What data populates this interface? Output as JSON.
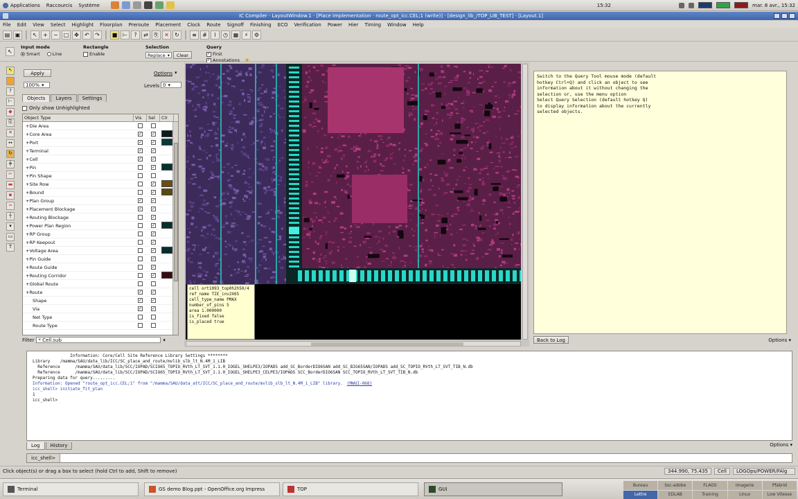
{
  "top_panel": {
    "menus": [
      "Applications",
      "Raccourcis",
      "Système"
    ],
    "clock": "mar. 8 avr., 15:32",
    "time_center": "15:32"
  },
  "window": {
    "title": "IC Compiler · LayoutWindow.1 · [Place Implementation · route_opt_icc.CEL;1 (write)] · [design_lib_/TOP_LIB_TEST] · [Layout.1]"
  },
  "menubar": [
    "File",
    "Edit",
    "View",
    "Select",
    "Highlight",
    "Floorplan",
    "Preroute",
    "Placement",
    "Clock",
    "Route",
    "Signoff",
    "Finishing",
    "ECO",
    "Verification",
    "Power",
    "Hier",
    "Timing",
    "Window",
    "Help"
  ],
  "options": {
    "input_mode": {
      "head": "Input mode",
      "smart": "Smart",
      "line": "Line"
    },
    "rect_type": {
      "head": "Rectangle",
      "enable": "Enable"
    },
    "selection": {
      "head": "Selection",
      "value": "Replace",
      "clear": "Clear"
    },
    "query": {
      "head": "Query",
      "first": "First",
      "annotations": "Annotations"
    }
  },
  "left_panel": {
    "apply": "Apply",
    "options_label": "Options",
    "zoom_value": "100%",
    "levels_label": "Levels",
    "levels_value": "0",
    "tabs": [
      "Objects",
      "Layers",
      "Settings"
    ],
    "show_highlighted": "Only show Unhighlighted",
    "columns": [
      "Object Type",
      "Vis",
      "Sel",
      "Clr"
    ],
    "rows": [
      {
        "name": "Die Area",
        "vis": false,
        "sel": false,
        "color": "",
        "sub": false
      },
      {
        "name": "Core Area",
        "vis": true,
        "sel": true,
        "color": "#0b1a1c",
        "sub": false
      },
      {
        "name": "Port",
        "vis": true,
        "sel": true,
        "color": "#083a3a",
        "sub": false
      },
      {
        "name": "Terminal",
        "vis": true,
        "sel": true,
        "color": "",
        "sub": false
      },
      {
        "name": "Cell",
        "vis": true,
        "sel": true,
        "color": "",
        "sub": false
      },
      {
        "name": "Pin",
        "vis": false,
        "sel": true,
        "color": "#04332e",
        "sub": false
      },
      {
        "name": "Pin Shape",
        "vis": false,
        "sel": false,
        "color": "",
        "sub": false
      },
      {
        "name": "Site Row",
        "vis": false,
        "sel": true,
        "color": "#6a4e0f",
        "sub": false
      },
      {
        "name": "Bound",
        "vis": false,
        "sel": true,
        "color": "#5a4a10",
        "sub": false
      },
      {
        "name": "Plan Group",
        "vis": true,
        "sel": true,
        "color": "",
        "sub": false
      },
      {
        "name": "Placement Blockage",
        "vis": true,
        "sel": true,
        "color": "",
        "sub": false
      },
      {
        "name": "Routing Blockage",
        "vis": false,
        "sel": true,
        "color": "",
        "sub": false
      },
      {
        "name": "Power Plan Region",
        "vis": false,
        "sel": true,
        "color": "#04302c",
        "sub": false
      },
      {
        "name": "RP Group",
        "vis": false,
        "sel": true,
        "color": "",
        "sub": false
      },
      {
        "name": "RP Keepout",
        "vis": false,
        "sel": true,
        "color": "",
        "sub": false
      },
      {
        "name": "Voltage Area",
        "vis": false,
        "sel": true,
        "color": "#052e2d",
        "sub": false
      },
      {
        "name": "Pin Guide",
        "vis": false,
        "sel": true,
        "color": "",
        "sub": false
      },
      {
        "name": "Route Guide",
        "vis": false,
        "sel": true,
        "color": "",
        "sub": false
      },
      {
        "name": "Routing Corridor",
        "vis": false,
        "sel": true,
        "color": "#3a0a10",
        "sub": false
      },
      {
        "name": "Global Route",
        "vis": false,
        "sel": false,
        "color": "",
        "sub": false
      },
      {
        "name": "Route",
        "vis": true,
        "sel": true,
        "color": "",
        "sub": false
      },
      {
        "name": "Shape",
        "vis": true,
        "sel": true,
        "color": "",
        "sub": true
      },
      {
        "name": "Via",
        "vis": true,
        "sel": true,
        "color": "",
        "sub": true
      },
      {
        "name": "Net Type",
        "vis": false,
        "sel": false,
        "color": "",
        "sub": true
      },
      {
        "name": "Route Type",
        "vis": false,
        "sel": false,
        "color": "",
        "sub": true
      }
    ],
    "filter_label": "Filter",
    "filter_value": "* Cell.sub"
  },
  "query_box": {
    "lines": [
      "cell  ort1093_top0h2h50/4",
      "ref_name  TIE_inv2X65",
      "cell_type_name  PMAX",
      "number_of_pins  5",
      "area  1.000000",
      "is_fixed  false",
      "is_placed  true"
    ]
  },
  "help_panel": {
    "text": "Switch to the Query Tool mouse mode (default\nhotkey Ctrl+Q) and click an object to see\ninformation about it without changing the\nselection or, use the menu option\nSelect Query Selection (default hotkey Q)\nto display information about the currently\nselected objects.",
    "back": "Back to Log",
    "options": "Options"
  },
  "console": {
    "lines": [
      {
        "text": "               Information: Core/Cell Site Reference Library Settings ********",
        "cls": ""
      },
      {
        "text": "",
        "cls": ""
      },
      {
        "text": "Library    /mamma/SAU/data_lib/ICC/SC_place_and_route/mvlib_slb_lt_N.4M_1_LIB",
        "cls": ""
      },
      {
        "text": "  Reference      /mamma/SAU/data_lib/SCC/IOPAD/SCIO65_TOPIO_RVth_LT_SVT_1.1.0_IOGEL_SHELPE3/IOPADS add_SC_BorderDIO6SAN add_SC_BIG65SAN/IOPADS add_SC_TOPIO_RVth_LT_SVT_TIB_N.db",
        "cls": ""
      },
      {
        "text": "  Reference      /mamma/SAU/data_lib/SCC/IOPAD/SCIO65_TOPIO_RVth_LT_SVT_1.1.0_IOGEL_SHELPE3_CELPE3/IOPADS SCC_BorderDIO6SAN SCC_TOPIO_RVth_LT_SVT_TIB_N.db",
        "cls": ""
      },
      {
        "text": "",
        "cls": ""
      },
      {
        "text": "",
        "cls": ""
      },
      {
        "text": "Preparing data for query.........",
        "cls": ""
      },
      {
        "text": "Information: Opened \"route_opt_icc.CEL;1\" from \"/mamma/SAU/data_att/ICC/SC_place_and_route/mvlib_slb_lt_N.4M_1_LIB\" library.",
        "cls": "blue",
        "link": "(MWUI-068)"
      },
      {
        "text": "icc_shell> initiate_fit_plan",
        "cls": "blue"
      },
      {
        "text": "1",
        "cls": ""
      },
      {
        "text": "icc_shell>",
        "cls": ""
      }
    ],
    "tabs": [
      "Log",
      "History"
    ],
    "options": "Options",
    "prompt": "icc_shell>"
  },
  "status": {
    "message": "Click object(s) or drag a box to select (hold Ctrl to add, Shift to remove)",
    "coords": "344.990, 75.435",
    "layer": "Cell",
    "path": "LOGOps/POWER/FAlg"
  },
  "taskbar": {
    "tasks": [
      {
        "label": "Terminal",
        "color": "#555"
      },
      {
        "label": "GS demo Blog.ppt - OpenOffice.org Impress",
        "color": "#c8552b"
      },
      {
        "label": "TOP",
        "color": "#b33"
      },
      {
        "label": "GUI",
        "color": "#2b4c2b"
      }
    ],
    "workspaces": [
      "Bureau",
      "Ssc-adobe",
      "FLAGS",
      "Imagerie",
      "Pfabrid",
      "Lettre",
      "EDLAB",
      "Training",
      "Linux",
      "Low Vitesse"
    ],
    "active_workspace": 5
  }
}
